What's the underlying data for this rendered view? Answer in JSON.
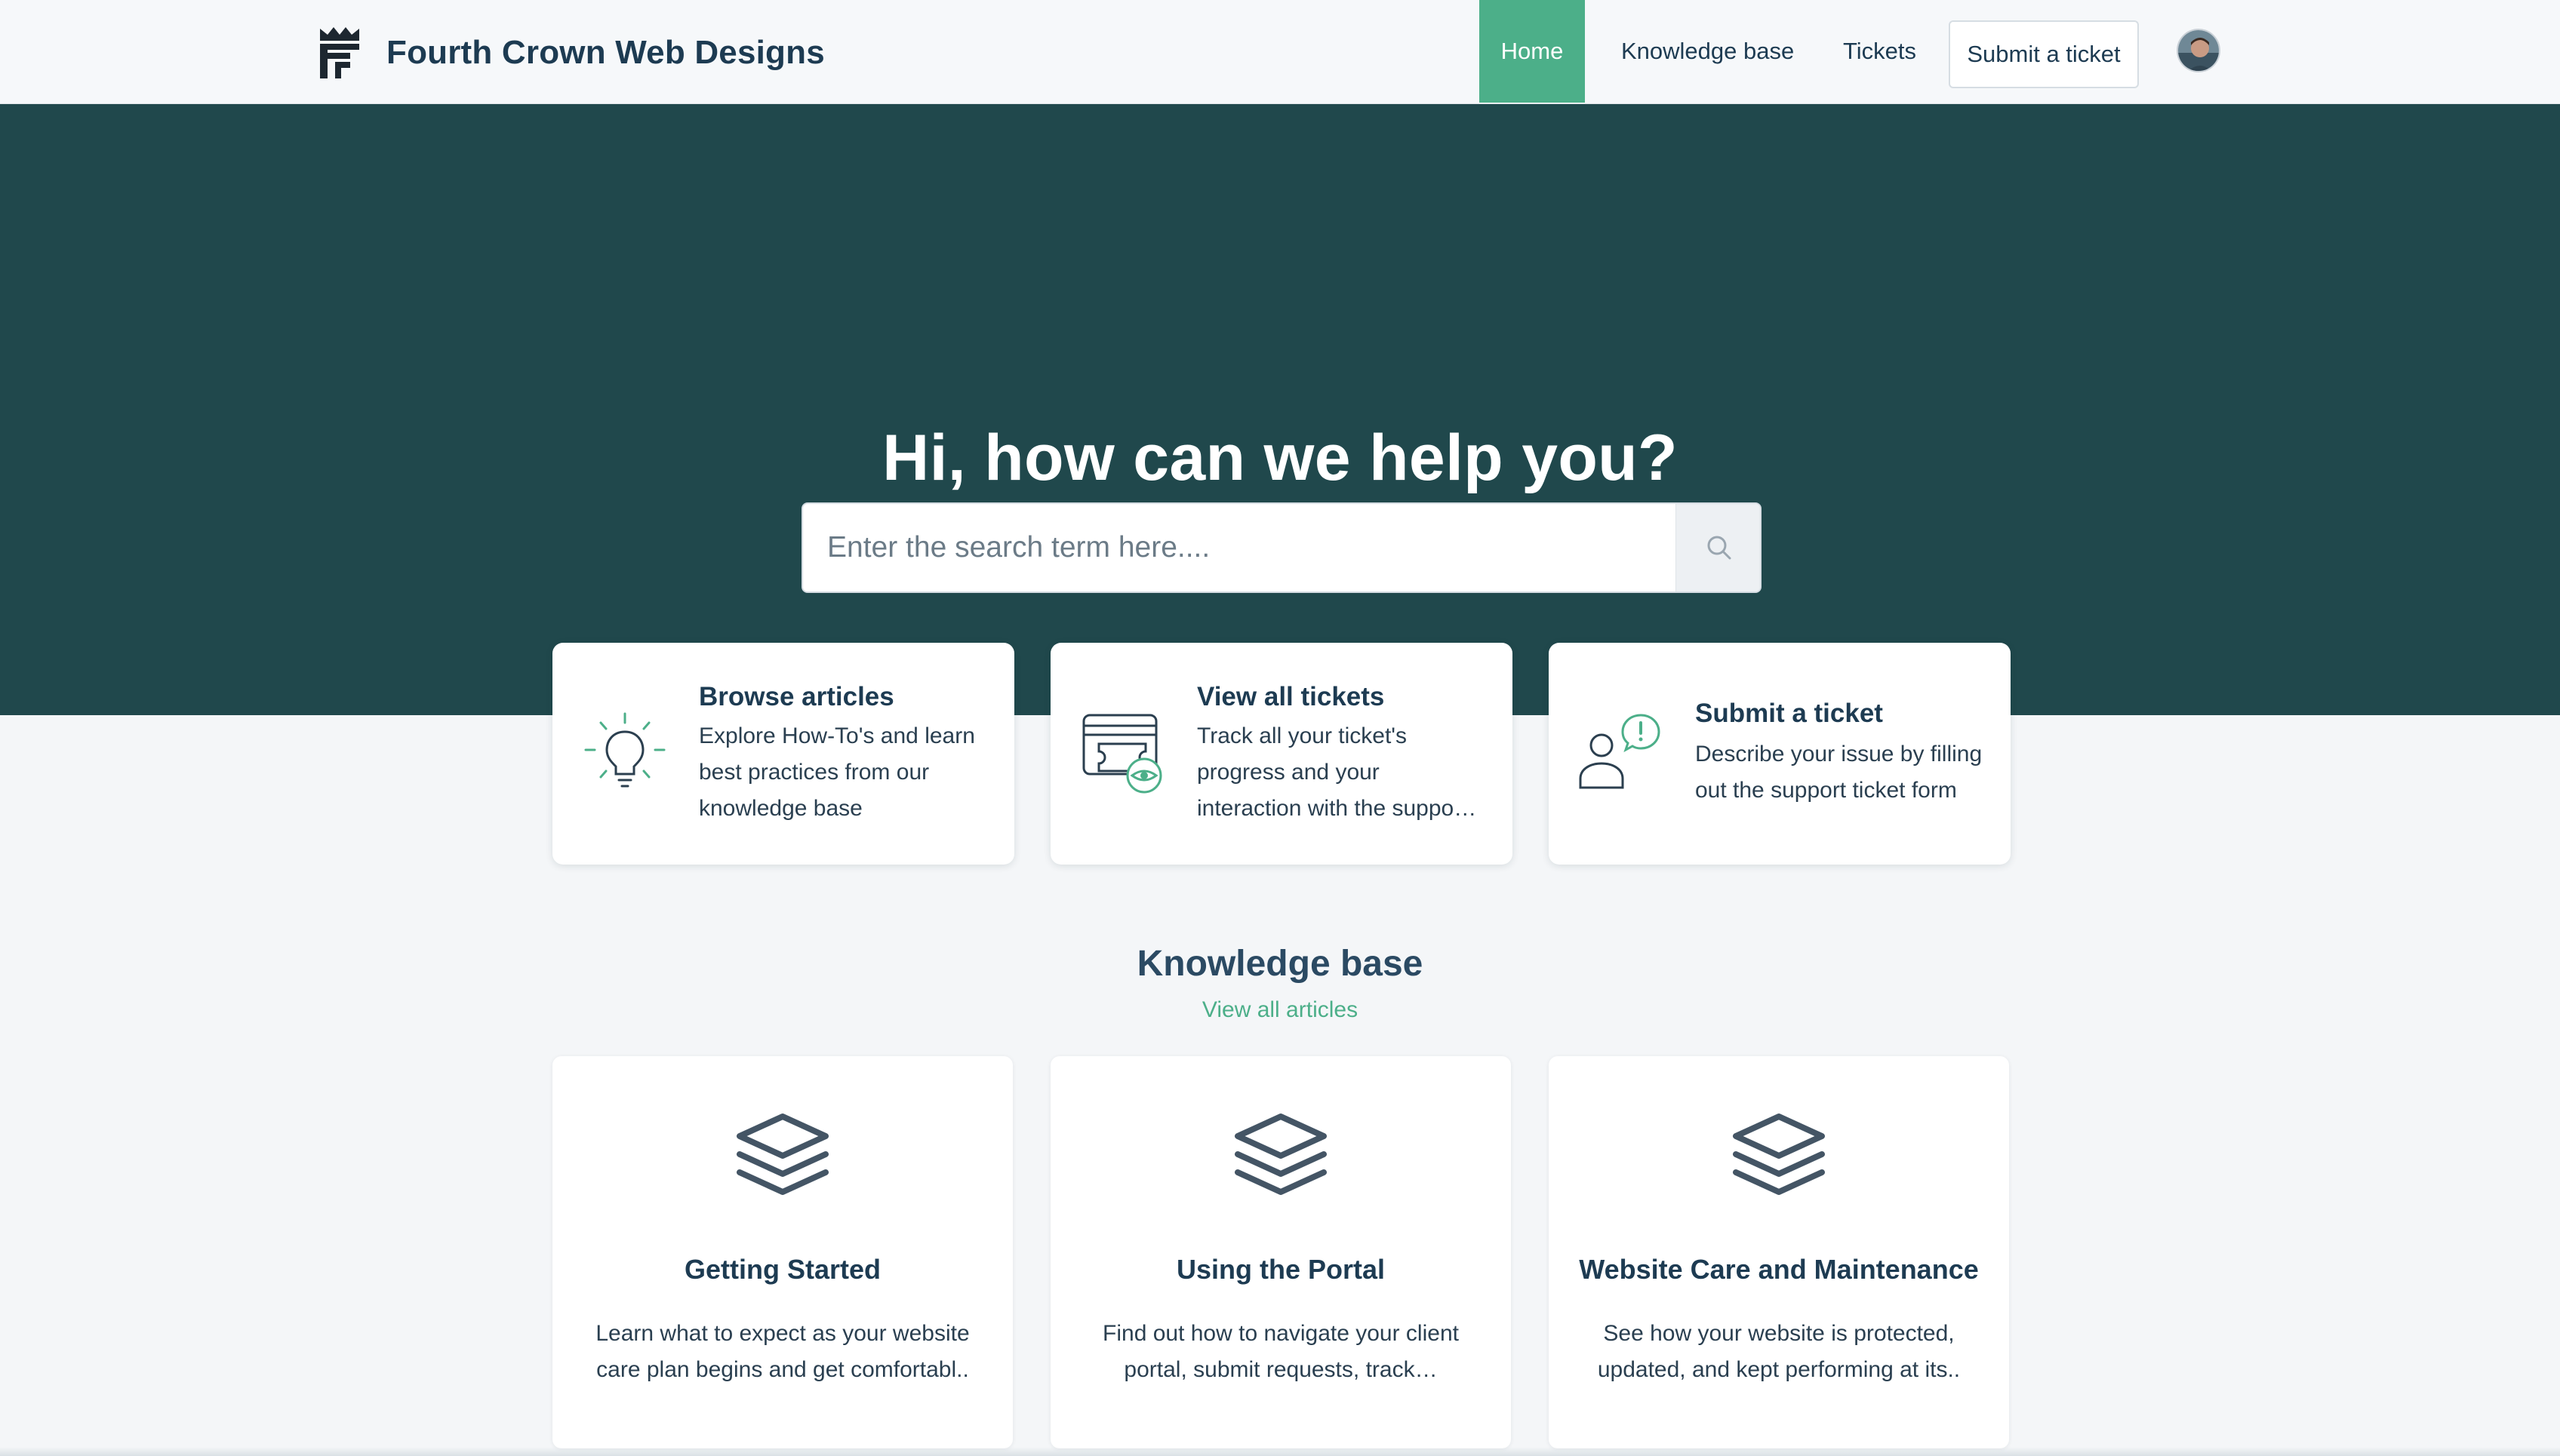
{
  "header": {
    "brand_name": "Fourth Crown Web Designs",
    "logo_icon": "crown-logo-icon",
    "nav": {
      "home": "Home",
      "knowledge_base": "Knowledge base",
      "tickets": "Tickets",
      "submit_ticket": "Submit a ticket"
    },
    "avatar_icon": "user-avatar"
  },
  "hero": {
    "title": "Hi, how can we help you?",
    "search_placeholder": "Enter the search term here....",
    "search_value": "",
    "search_icon": "search-icon"
  },
  "quick_links": [
    {
      "icon": "lightbulb-icon",
      "title": "Browse articles",
      "description": "Explore How-To's and learn best practices from our knowledge base"
    },
    {
      "icon": "tickets-view-icon",
      "title": "View all tickets",
      "description_lines": [
        "Track all your ticket's",
        "progress and your",
        "interaction with the suppo…"
      ]
    },
    {
      "icon": "person-alert-icon",
      "title": "Submit a ticket",
      "description": "Describe your issue by filling out the support ticket form"
    }
  ],
  "knowledge_base": {
    "title": "Knowledge base",
    "view_all": "View all articles",
    "categories": [
      {
        "icon": "layers-icon",
        "title": "Getting Started",
        "description_lines": [
          "Learn what to expect as your website",
          "care plan begins and get comfortabl.."
        ]
      },
      {
        "icon": "layers-icon",
        "title": "Using the Portal",
        "description_lines": [
          "Find out how to navigate your client",
          "portal, submit requests, track…"
        ]
      },
      {
        "icon": "layers-icon",
        "title": "Website Care and Maintenance",
        "description_lines": [
          "See how your website is protected,",
          "updated, and kept performing at its.."
        ]
      }
    ]
  },
  "colors": {
    "accent": "#4caf89",
    "hero_bg": "#20484c",
    "text_dark": "#1d3b52"
  }
}
